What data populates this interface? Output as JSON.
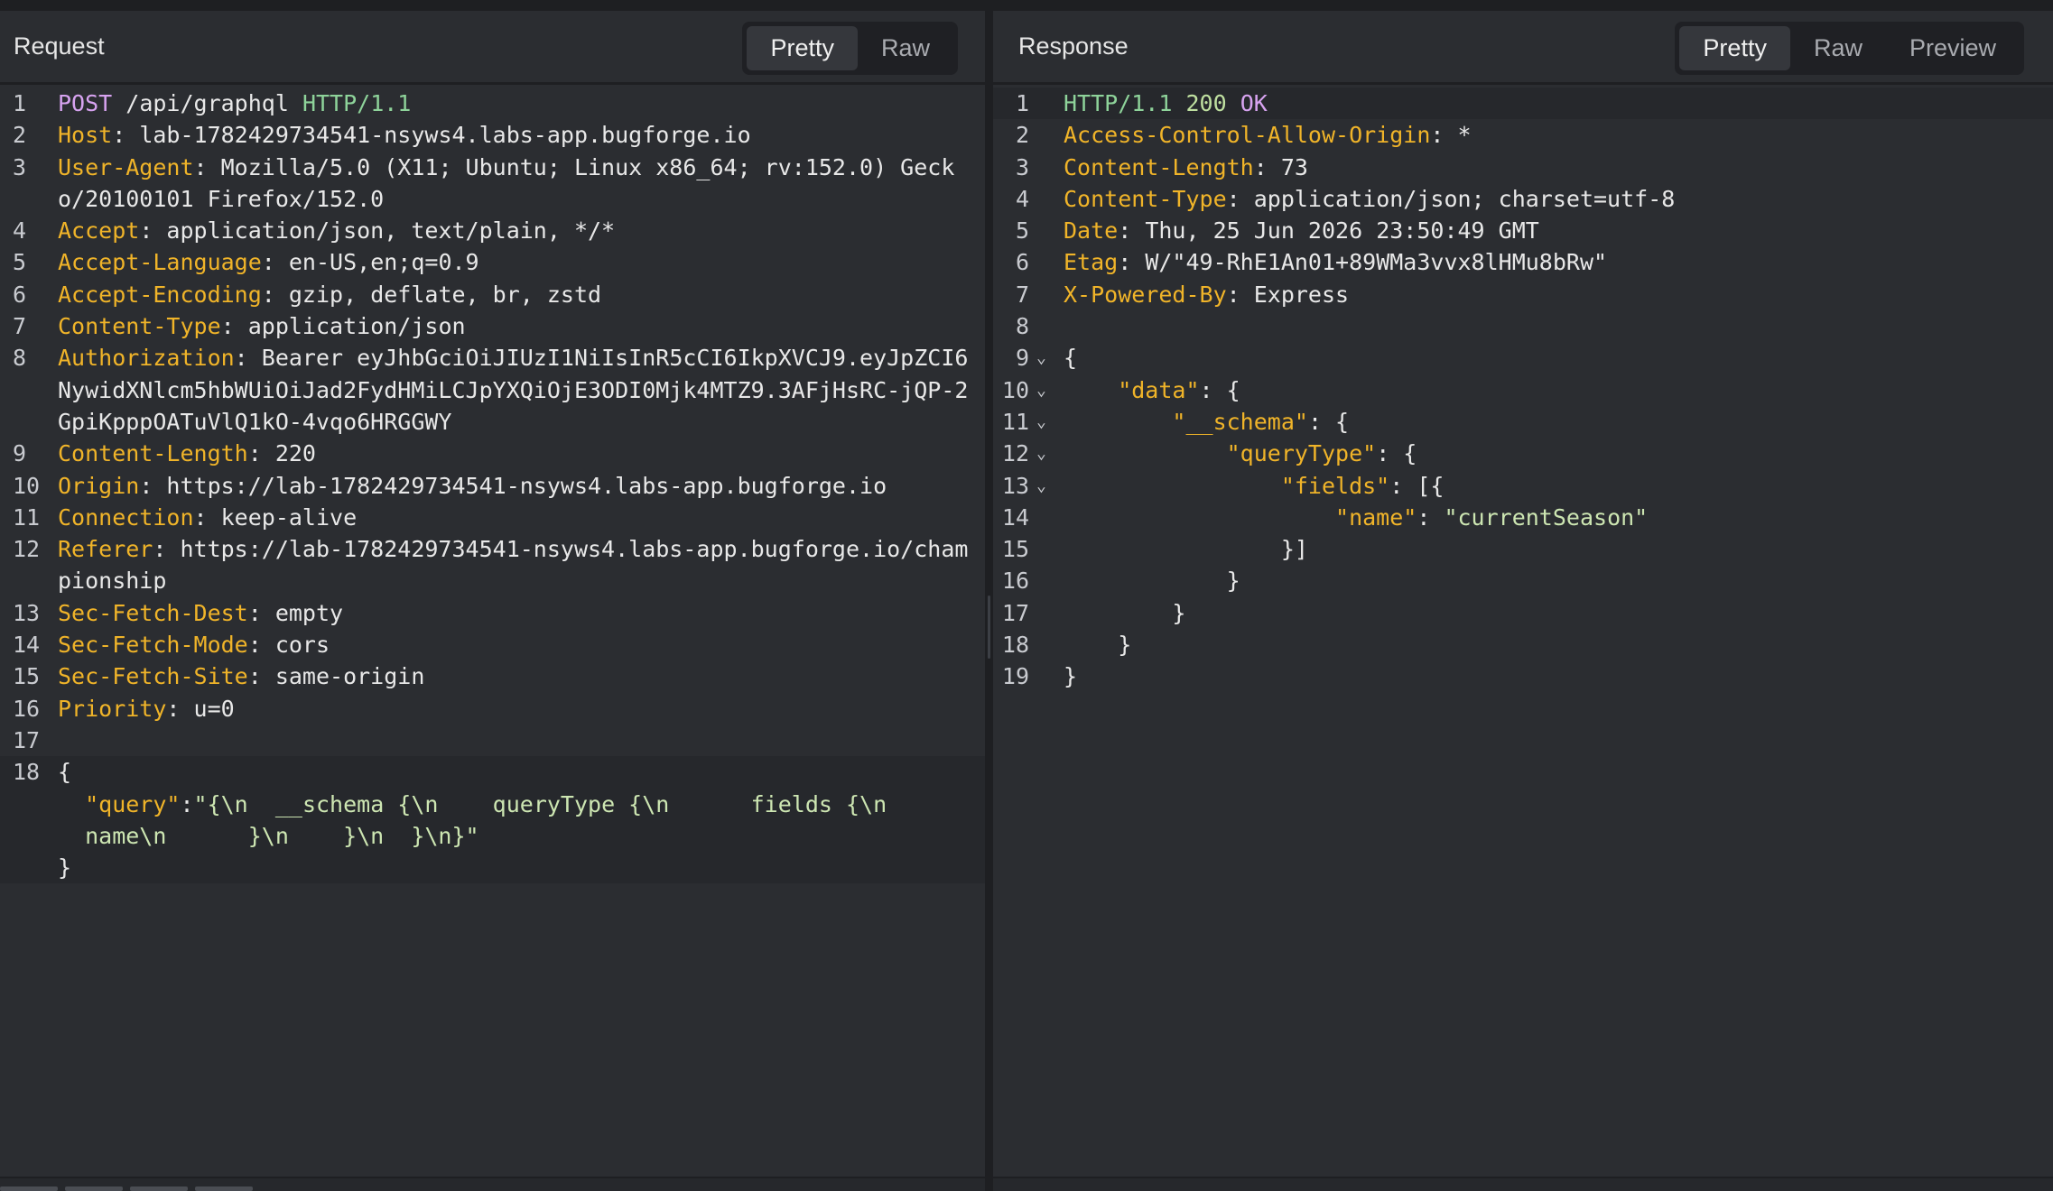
{
  "request": {
    "title": "Request",
    "tabs": [
      {
        "label": "Pretty",
        "active": true
      },
      {
        "label": "Raw",
        "active": false
      }
    ],
    "lines": [
      {
        "n": "1",
        "method": "POST",
        "path": " /api/graphql ",
        "proto": "HTTP/1.1"
      },
      {
        "n": "2",
        "key": "Host",
        "val": ": lab-1782429734541-nsyws4.labs-app.bugforge.io"
      },
      {
        "n": "3",
        "key": "User-Agent",
        "val": ": Mozilla/5.0 (X11; Ubuntu; Linux x86_64; rv:152.0) Geck"
      },
      {
        "n": "",
        "val": "o/20100101 Firefox/152.0"
      },
      {
        "n": "4",
        "key": "Accept",
        "val": ": application/json, text/plain, */*"
      },
      {
        "n": "5",
        "key": "Accept-Language",
        "val": ": en-US,en;q=0.9"
      },
      {
        "n": "6",
        "key": "Accept-Encoding",
        "val": ": gzip, deflate, br, zstd"
      },
      {
        "n": "7",
        "key": "Content-Type",
        "val": ": application/json"
      },
      {
        "n": "8",
        "key": "Authorization",
        "val": ": Bearer eyJhbGciOiJIUzI1NiIsInR5cCI6IkpXVCJ9.eyJpZCI6"
      },
      {
        "n": "",
        "val": "NywidXNlcm5hbWUiOiJad2FydHMiLCJpYXQiOjE3ODI0Mjk4MTZ9.3AFjHsRC-jQP-2"
      },
      {
        "n": "",
        "val": "GpiKpppOATuVlQ1kO-4vqo6HRGGWY"
      },
      {
        "n": "9",
        "key": "Content-Length",
        "val": ": 220"
      },
      {
        "n": "10",
        "key": "Origin",
        "val": ": https://lab-1782429734541-nsyws4.labs-app.bugforge.io"
      },
      {
        "n": "11",
        "key": "Connection",
        "val": ": keep-alive"
      },
      {
        "n": "12",
        "key": "Referer",
        "val": ": https://lab-1782429734541-nsyws4.labs-app.bugforge.io/cham"
      },
      {
        "n": "",
        "val": "pionship"
      },
      {
        "n": "13",
        "key": "Sec-Fetch-Dest",
        "val": ": empty"
      },
      {
        "n": "14",
        "key": "Sec-Fetch-Mode",
        "val": ": cors"
      },
      {
        "n": "15",
        "key": "Sec-Fetch-Site",
        "val": ": same-origin"
      },
      {
        "n": "16",
        "key": "Priority",
        "val": ": u=0"
      },
      {
        "n": "17",
        "val": ""
      },
      {
        "n": "18",
        "val": "{",
        "hl": true
      },
      {
        "n": "",
        "key": "  \"query\"",
        "val": ":",
        "str": "\"{\\n  __schema {\\n    queryType {\\n      fields {\\n",
        "hl": true
      },
      {
        "n": "",
        "str": "  name\\n      }\\n    }\\n  }\\n}\"",
        "hl": true
      },
      {
        "n": "",
        "val": "}",
        "hl": true
      }
    ]
  },
  "response": {
    "title": "Response",
    "tabs": [
      {
        "label": "Pretty",
        "active": true
      },
      {
        "label": "Raw",
        "active": false
      },
      {
        "label": "Preview",
        "active": false
      }
    ],
    "lines": [
      {
        "n": "1",
        "proto": "HTTP/1.1",
        "status": " 200 ",
        "ok": "OK",
        "hl": true
      },
      {
        "n": "2",
        "key": "Access-Control-Allow-Origin",
        "val": ": *"
      },
      {
        "n": "3",
        "key": "Content-Length",
        "val": ": 73"
      },
      {
        "n": "4",
        "key": "Content-Type",
        "val": ": application/json; charset=utf-8"
      },
      {
        "n": "5",
        "key": "Date",
        "val": ": Thu, 25 Jun 2026 23:50:49 GMT"
      },
      {
        "n": "6",
        "key": "Etag",
        "val": ": W/\"49-RhE1An01+89WMa3vvx8lHMu8bRw\""
      },
      {
        "n": "7",
        "key": "X-Powered-By",
        "val": ": Express"
      },
      {
        "n": "8",
        "val": ""
      },
      {
        "n": "9",
        "fold": true,
        "val": "{"
      },
      {
        "n": "10",
        "fold": true,
        "key": "    \"data\"",
        "val": ": {"
      },
      {
        "n": "11",
        "fold": true,
        "key": "        \"__schema\"",
        "val": ": {"
      },
      {
        "n": "12",
        "fold": true,
        "key": "            \"queryType\"",
        "val": ": {"
      },
      {
        "n": "13",
        "fold": true,
        "key": "                \"fields\"",
        "val": ": [{"
      },
      {
        "n": "14",
        "key": "                    \"name\"",
        "val": ": ",
        "str": "\"currentSeason\""
      },
      {
        "n": "15",
        "val": "                }]"
      },
      {
        "n": "16",
        "val": "            }"
      },
      {
        "n": "17",
        "val": "        }"
      },
      {
        "n": "18",
        "val": "    }"
      },
      {
        "n": "19",
        "val": "}"
      }
    ]
  }
}
